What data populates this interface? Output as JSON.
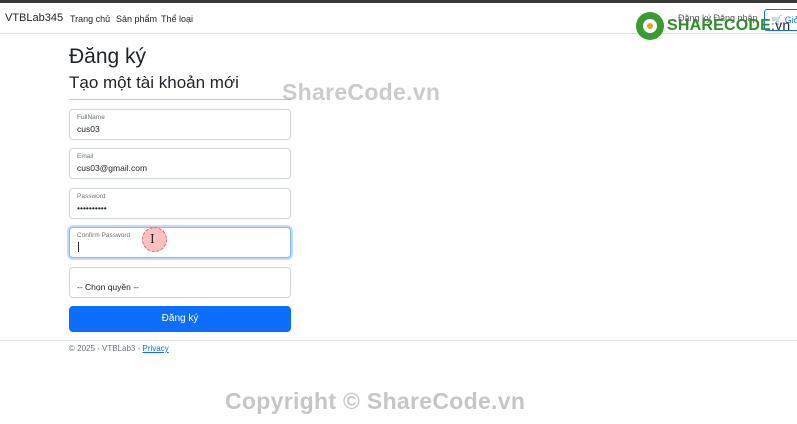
{
  "navbar": {
    "brand": "VTBLab345",
    "links": [
      "Trang chủ",
      "Sản phẩm",
      "Thể loại"
    ],
    "right_text": "Đăng ký   Đăng nhập",
    "cart_label": "🛒 Giỏ"
  },
  "logo": {
    "name": "SHARECODE",
    "suffix": ".vn"
  },
  "page": {
    "title": "Đăng ký",
    "subtitle": "Tạo một tài khoản mới"
  },
  "form": {
    "fullname": {
      "label": "FullName",
      "value": "cus03"
    },
    "email": {
      "label": "Email",
      "value": "cus03@gmail.com"
    },
    "password": {
      "label": "Password",
      "value": "••••••••••"
    },
    "confirm_password": {
      "label": "Confirm Password",
      "value": ""
    },
    "role": {
      "selected": "-- Chọn quyền --"
    },
    "submit_label": "Đăng ký"
  },
  "footer": {
    "text": "© 2025 - VTBLab3 - ",
    "privacy": "Privacy"
  },
  "watermarks": {
    "middle": "ShareCode.vn",
    "bottom": "Copyright © ShareCode.vn"
  },
  "colors": {
    "primary": "#0d6efd",
    "logo_green": "#3a9b35",
    "logo_orange": "#f29c1f"
  }
}
